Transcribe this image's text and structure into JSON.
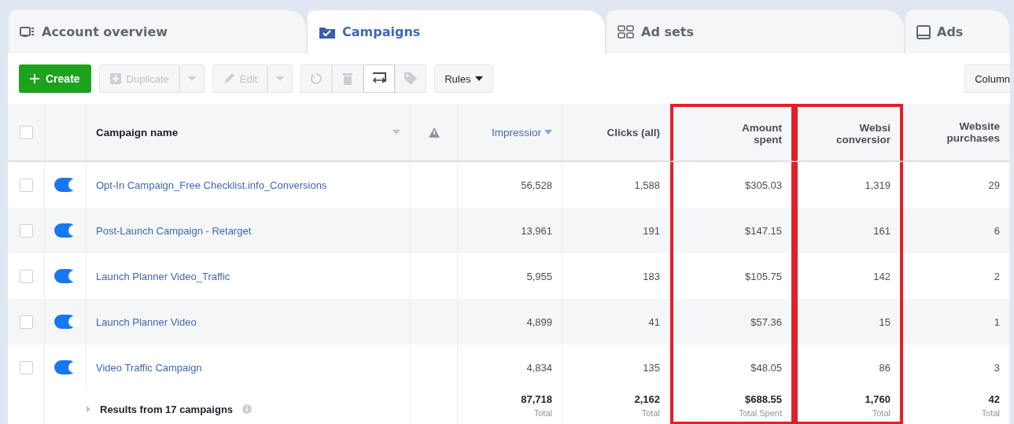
{
  "tabs": [
    {
      "label": "Account overview",
      "selected": false
    },
    {
      "label": "Campaigns",
      "selected": true
    },
    {
      "label": "Ad sets",
      "selected": false
    },
    {
      "label": "Ads",
      "selected": false
    }
  ],
  "toolbar": {
    "create": {
      "label": "Create"
    },
    "duplicate": {
      "label": "Duplicate",
      "disabled": true
    },
    "edit": {
      "label": "Edit",
      "disabled": true
    },
    "icon_buttons": [
      {
        "kind": "refresh",
        "disabled": true
      },
      {
        "kind": "delete",
        "disabled": true
      },
      {
        "kind": "swap",
        "disabled": false
      },
      {
        "kind": "tag",
        "disabled": true
      }
    ],
    "rules": {
      "label": "Rules"
    },
    "columns_button": {
      "label": "Column"
    }
  },
  "table": {
    "select_all": {
      "checked": false
    },
    "name_header": "Campaign name",
    "columns": [
      {
        "label": "Impressior",
        "sorted": true,
        "highlighted": false
      },
      {
        "label": "Clicks (all)",
        "sorted": false,
        "highlighted": false
      },
      {
        "label": "Amount spent",
        "sorted": false,
        "highlighted": true
      },
      {
        "label": "Websi conversior",
        "sorted": false,
        "highlighted": true
      },
      {
        "label": "Website purchases",
        "sorted": false,
        "highlighted": false
      }
    ],
    "rows": [
      {
        "checked": false,
        "on": true,
        "name": "Opt-In Campaign_Free Checklist.info_Conversions",
        "values": [
          "56,528",
          "1,588",
          "$305.03",
          "1,319",
          "29"
        ]
      },
      {
        "checked": false,
        "on": true,
        "name": "Post-Launch Campaign - Retarget",
        "values": [
          "13,961",
          "191",
          "$147.15",
          "161",
          "6"
        ]
      },
      {
        "checked": false,
        "on": true,
        "name": "Launch Planner Video_Traffic",
        "values": [
          "5,955",
          "183",
          "$105.75",
          "142",
          "2"
        ]
      },
      {
        "checked": false,
        "on": true,
        "name": "Launch Planner Video",
        "values": [
          "4,899",
          "41",
          "$57.36",
          "15",
          "1"
        ]
      },
      {
        "checked": false,
        "on": true,
        "name": "Video Traffic Campaign",
        "values": [
          "4,834",
          "135",
          "$48.05",
          "86",
          "3"
        ]
      }
    ],
    "totals": {
      "label": "Results from 17 campaigns",
      "values": [
        {
          "value": "87,718",
          "caption": "Total"
        },
        {
          "value": "2,162",
          "caption": "Total"
        },
        {
          "value": "$688.55",
          "caption": "Total Spent"
        },
        {
          "value": "1,760",
          "caption": "Total"
        },
        {
          "value": "42",
          "caption": "Total"
        }
      ]
    }
  }
}
